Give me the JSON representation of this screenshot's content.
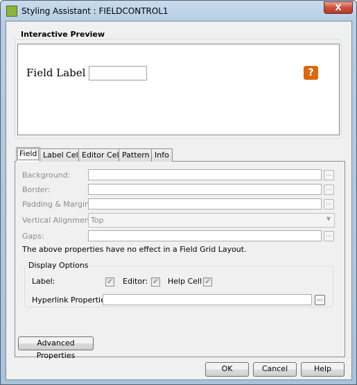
{
  "window": {
    "title": "Styling Assistant : FIELDCONTROL1",
    "close_label": "X"
  },
  "preview": {
    "group_label": "Interactive Preview",
    "field_label": "Field Label",
    "field_value": "",
    "help_icon_label": "?"
  },
  "tabs": [
    {
      "label": "Field",
      "selected": true
    },
    {
      "label": "Label Cell"
    },
    {
      "label": "Editor Cell"
    },
    {
      "label": "Pattern"
    },
    {
      "label": "Info"
    }
  ],
  "field": {
    "background_label": "Background:",
    "background_value": "",
    "border_label": "Border:",
    "border_value": "",
    "padding_label": "Padding & Margin:",
    "padding_value": "",
    "valign_label": "Vertical Alignment:",
    "valign_value": "Top",
    "gaps_label": "Gaps:",
    "gaps_value": "",
    "browse_label": "...",
    "note": "The above properties have no effect in a Field Grid Layout."
  },
  "display_options": {
    "group_label": "Display Options",
    "label_label": "Label:",
    "label_checked": true,
    "editor_label": "Editor:",
    "editor_checked": true,
    "help_cell_label": "Help Cell",
    "help_cell_checked": true,
    "hyperlink_label": "Hyperlink Properties",
    "hyperlink_value": "",
    "check_glyph": "✓"
  },
  "buttons": {
    "advanced": "Advanced Properties",
    "ok": "OK",
    "cancel": "Cancel",
    "help": "Help"
  }
}
